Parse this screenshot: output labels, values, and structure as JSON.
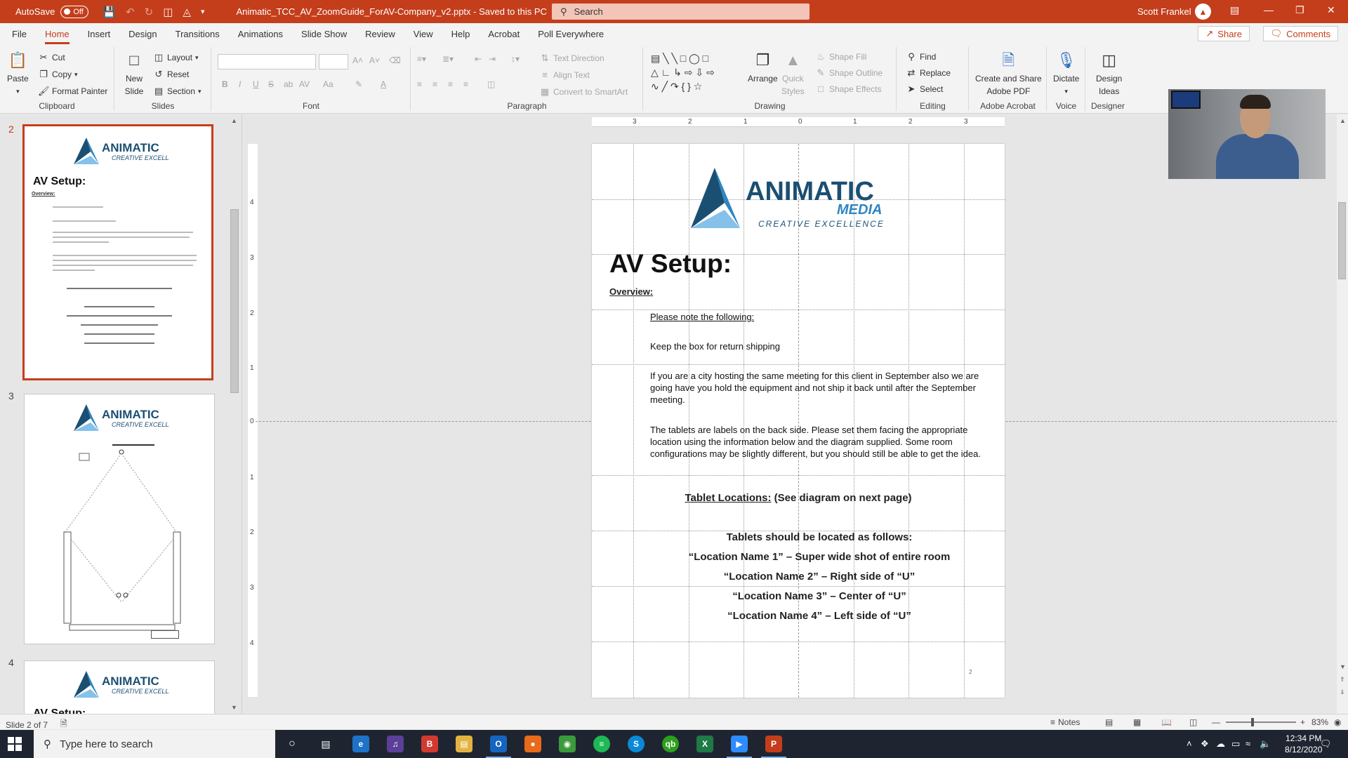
{
  "titlebar": {
    "autosave_label": "AutoSave",
    "autosave_state": "Off",
    "doc_title": "Animatic_TCC_AV_ZoomGuide_ForAV-Company_v2.pptx  -  Saved to this PC",
    "search_placeholder": "Search",
    "user_name": "Scott Frankel",
    "accent": "#c43e1c"
  },
  "ribbon_tabs": [
    "File",
    "Home",
    "Insert",
    "Design",
    "Transitions",
    "Animations",
    "Slide Show",
    "Review",
    "View",
    "Help",
    "Acrobat",
    "Poll Everywhere"
  ],
  "ribbon_actions": {
    "share": "Share",
    "comments": "Comments"
  },
  "ribbon": {
    "clipboard": {
      "label": "Clipboard",
      "paste": "Paste",
      "cut": "Cut",
      "copy": "Copy",
      "format_painter": "Format Painter"
    },
    "slides": {
      "label": "Slides",
      "new_slide_1": "New",
      "new_slide_2": "Slide",
      "layout": "Layout",
      "reset": "Reset",
      "section": "Section"
    },
    "font": {
      "label": "Font",
      "bold": "B",
      "italic": "I",
      "underline": "U",
      "strike": "S",
      "spacing": "AV",
      "case": "Aa"
    },
    "paragraph": {
      "label": "Paragraph",
      "text_direction": "Text Direction",
      "align_text": "Align Text",
      "convert_smartart": "Convert to SmartArt"
    },
    "drawing": {
      "label": "Drawing",
      "arrange": "Arrange",
      "quick_styles_1": "Quick",
      "quick_styles_2": "Styles",
      "shape_fill": "Shape Fill",
      "shape_outline": "Shape Outline",
      "shape_effects": "Shape Effects"
    },
    "editing": {
      "label": "Editing",
      "find": "Find",
      "replace": "Replace",
      "select": "Select"
    },
    "acrobat": {
      "label": "Adobe Acrobat",
      "create_1": "Create and Share",
      "create_2": "Adobe PDF"
    },
    "voice": {
      "label": "Voice",
      "dictate": "Dictate"
    },
    "designer": {
      "label": "Designer",
      "design_ideas_1": "Design",
      "design_ideas_2": "Ideas"
    }
  },
  "thumbnails": [
    {
      "number": "2",
      "title": "AV Setup:",
      "overview": "Overview:"
    },
    {
      "number": "3"
    },
    {
      "number": "4",
      "title": "AV Setup:"
    }
  ],
  "slide": {
    "logo_main": "ANIMATIC",
    "logo_sub": "MEDIA",
    "logo_tag": "CREATIVE EXCELLENCE",
    "title": "AV Setup:",
    "overview": "Overview:",
    "notes": [
      "Please note the following:",
      "Keep the box for return shipping",
      "If you are a city hosting the same meeting for this client in September also we are going have you hold the equipment and not ship it back until after the September meeting.",
      "The tablets are labels on the back side. Please set them facing the appropriate location using the information below and the diagram supplied. Some room configurations may be slightly different, but you should still be able to get the idea."
    ],
    "tablet_locations_label": "Tablet Locations:",
    "tablet_locations_note": " (See diagram on next page)",
    "locations_heading": "Tablets should be located as follows:",
    "locations": [
      "“Location Name 1” – Super wide shot of entire room",
      "“Location Name 2” – Right side of “U”",
      "“Location Name 3” – Center of “U”",
      "“Location Name 4” – Left side of “U”"
    ],
    "page_number": "2"
  },
  "ruler": {
    "h": [
      "3",
      "2",
      "1",
      "0",
      "1",
      "2",
      "3"
    ],
    "v": [
      "4",
      "3",
      "2",
      "1",
      "0",
      "1",
      "2",
      "3",
      "4"
    ]
  },
  "statusbar": {
    "slide_info": "Slide 2 of 7",
    "notes": "Notes",
    "zoom": "83%"
  },
  "taskbar": {
    "search_placeholder": "Type here to search",
    "time": "12:34 PM",
    "date": "8/12/2020"
  }
}
